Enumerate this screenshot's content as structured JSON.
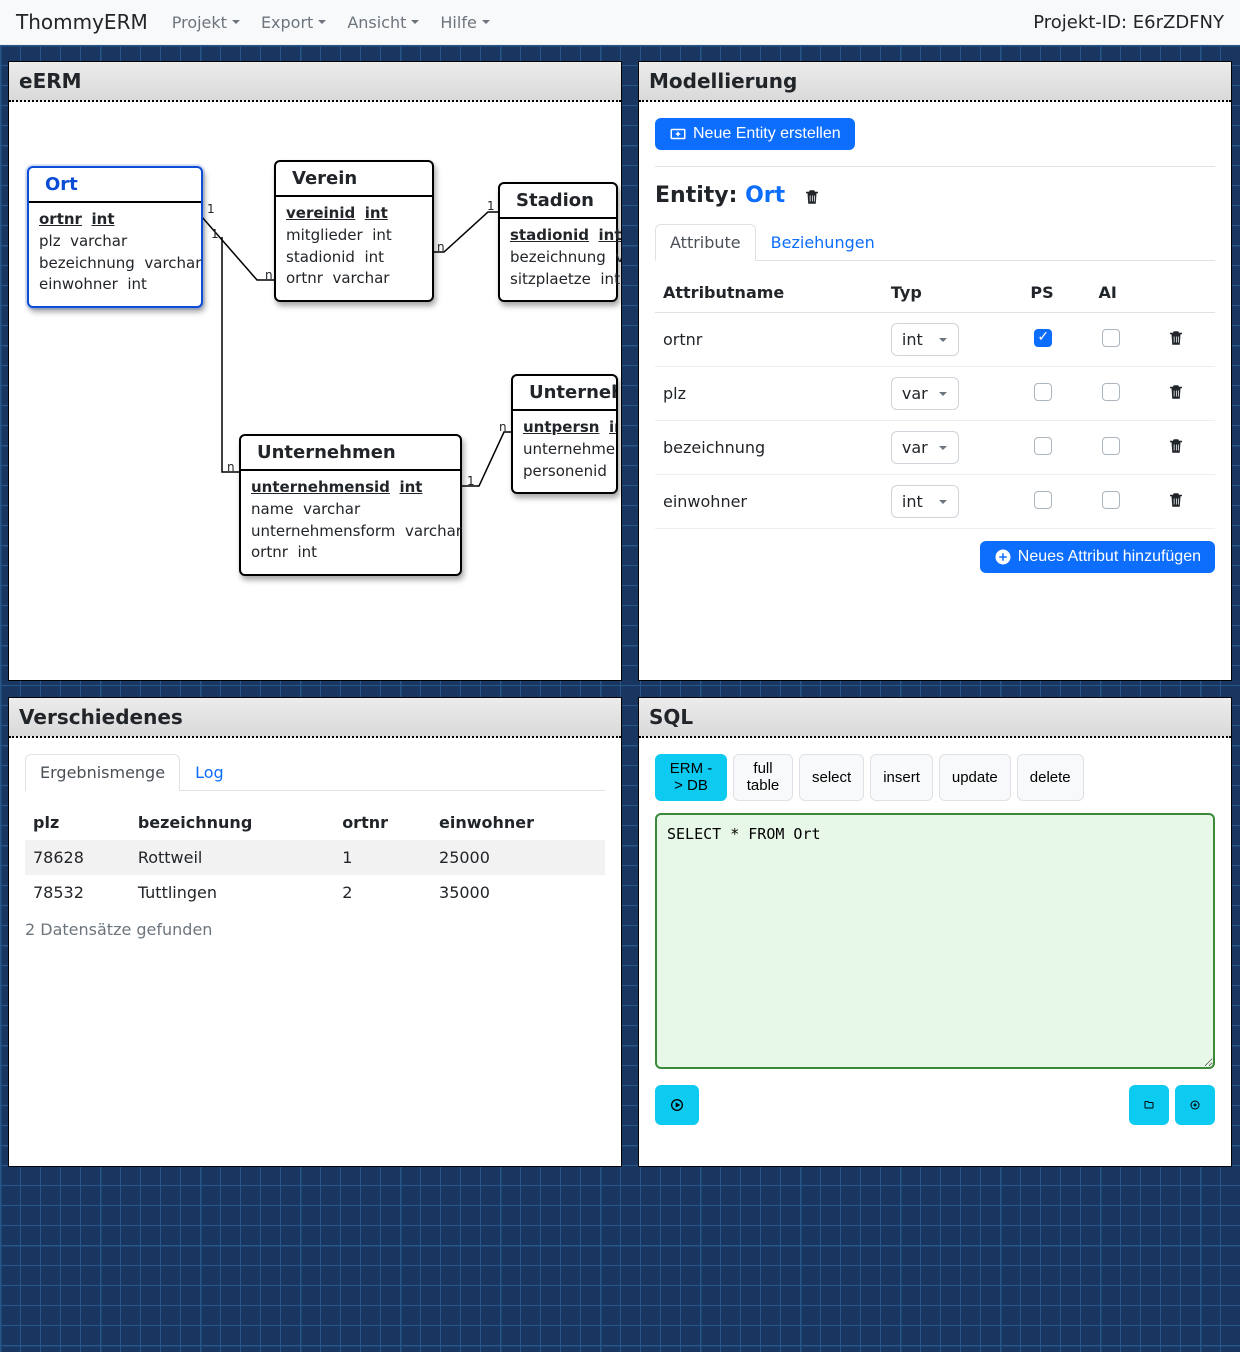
{
  "nav": {
    "brand": "ThommyERM",
    "items": [
      "Projekt",
      "Export",
      "Ansicht",
      "Hilfe"
    ],
    "project_id_label": "Projekt-ID:",
    "project_id": "E6rZDFNY"
  },
  "panels": {
    "erm": {
      "title": "eERM",
      "entities": {
        "ort": {
          "name": "Ort",
          "attrs": [
            {
              "name": "ortnr",
              "type": "int",
              "pk": true
            },
            {
              "name": "plz",
              "type": "varchar"
            },
            {
              "name": "bezeichnung",
              "type": "varchar"
            },
            {
              "name": "einwohner",
              "type": "int"
            }
          ]
        },
        "verein": {
          "name": "Verein",
          "attrs": [
            {
              "name": "vereinid",
              "type": "int",
              "pk": true
            },
            {
              "name": "mitglieder",
              "type": "int"
            },
            {
              "name": "stadionid",
              "type": "int"
            },
            {
              "name": "ortnr",
              "type": "varchar"
            }
          ]
        },
        "stadion": {
          "name": "Stadion",
          "attrs": [
            {
              "name": "stadionid",
              "type": "int",
              "pk": true
            },
            {
              "name": "bezeichnung",
              "type": "varchar"
            },
            {
              "name": "sitzplaetze",
              "type": "int"
            }
          ]
        },
        "unternehmen": {
          "name": "Unternehmen",
          "attrs": [
            {
              "name": "unternehmensid",
              "type": "int",
              "pk": true
            },
            {
              "name": "name",
              "type": "varchar"
            },
            {
              "name": "unternehmensform",
              "type": "varchar"
            },
            {
              "name": "ortnr",
              "type": "int"
            }
          ]
        },
        "untpers": {
          "name": "Unterneh",
          "attrs": [
            {
              "name": "untpersn",
              "type": "int",
              "pk": true
            },
            {
              "name": "unternehme",
              "type": ""
            },
            {
              "name": "personenid",
              "type": ""
            }
          ]
        }
      },
      "cardinalities": {
        "one": "1",
        "many": "n"
      }
    },
    "model": {
      "title": "Modellierung",
      "new_entity": "Neue Entity erstellen",
      "entity_label": "Entity:",
      "entity_name": "Ort",
      "tabs": {
        "attrs": "Attribute",
        "rels": "Beziehungen"
      },
      "cols": {
        "name": "Attributname",
        "type": "Typ",
        "ps": "PS",
        "ai": "AI"
      },
      "rows": [
        {
          "name": "ortnr",
          "type": "int",
          "ps": true,
          "ai": false
        },
        {
          "name": "plz",
          "type": "var",
          "ps": false,
          "ai": false
        },
        {
          "name": "bezeichnung",
          "type": "var",
          "ps": false,
          "ai": false
        },
        {
          "name": "einwohner",
          "type": "int",
          "ps": false,
          "ai": false
        }
      ],
      "add_attr": "Neues Attribut hinzufügen"
    },
    "misc": {
      "title": "Verschiedenes",
      "tabs": {
        "result": "Ergebnismenge",
        "log": "Log"
      },
      "cols": [
        "plz",
        "bezeichnung",
        "ortnr",
        "einwohner"
      ],
      "rows": [
        {
          "plz": "78628",
          "bezeichnung": "Rottweil",
          "ortnr": "1",
          "einwohner": "25000"
        },
        {
          "plz": "78532",
          "bezeichnung": "Tuttlingen",
          "ortnr": "2",
          "einwohner": "35000"
        }
      ],
      "count": "2 Datensätze gefunden"
    },
    "sql": {
      "title": "SQL",
      "buttons": {
        "ermdb": "ERM -> DB",
        "fulltable": "full table",
        "select": "select",
        "insert": "insert",
        "update": "update",
        "delete": "delete"
      },
      "query": "SELECT * FROM Ort"
    }
  }
}
